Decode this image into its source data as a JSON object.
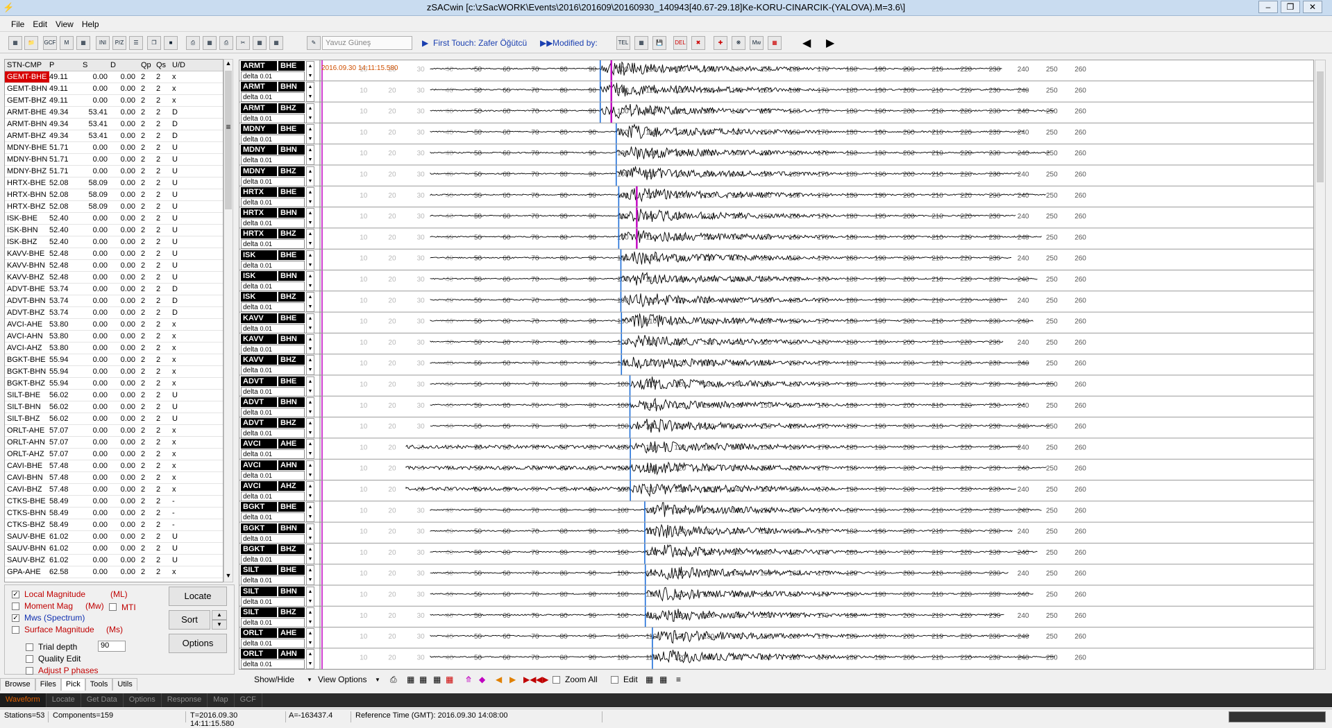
{
  "window": {
    "title": "zSACwin [c:\\zSacWORK\\Events\\2016\\201609\\20160930_140943[40.67-29.18]Ke-KORU-CINARCIK-(YALOVA).M=3.6\\]"
  },
  "menu": [
    "File",
    "Edit",
    "View",
    "Help"
  ],
  "toolbar": {
    "icons": [
      "gcf-icon",
      "ini-icon",
      "pole-zero-icon",
      "save-icon"
    ],
    "analyst_placeholder": "Yavuz Güneş",
    "first_touch": "First Touch: Zafer Öğütcü",
    "modified_by": "Modified by:"
  },
  "station_table": {
    "headers": [
      "STN-CMP",
      "P",
      "S",
      "D",
      "Qp",
      "Qs",
      "U/D"
    ],
    "rows": [
      [
        "GEMT-BHE",
        "49.11",
        "0.00",
        "0.00",
        "2",
        "2",
        "x"
      ],
      [
        "GEMT-BHN",
        "49.11",
        "0.00",
        "0.00",
        "2",
        "2",
        "x"
      ],
      [
        "GEMT-BHZ",
        "49.11",
        "0.00",
        "0.00",
        "2",
        "2",
        "x"
      ],
      [
        "ARMT-BHE",
        "49.34",
        "53.41",
        "0.00",
        "2",
        "2",
        "D"
      ],
      [
        "ARMT-BHN",
        "49.34",
        "53.41",
        "0.00",
        "2",
        "2",
        "D"
      ],
      [
        "ARMT-BHZ",
        "49.34",
        "53.41",
        "0.00",
        "2",
        "2",
        "D"
      ],
      [
        "MDNY-BHE",
        "51.71",
        "0.00",
        "0.00",
        "2",
        "2",
        "U"
      ],
      [
        "MDNY-BHN",
        "51.71",
        "0.00",
        "0.00",
        "2",
        "2",
        "U"
      ],
      [
        "MDNY-BHZ",
        "51.71",
        "0.00",
        "0.00",
        "2",
        "2",
        "U"
      ],
      [
        "HRTX-BHE",
        "52.08",
        "58.09",
        "0.00",
        "2",
        "2",
        "U"
      ],
      [
        "HRTX-BHN",
        "52.08",
        "58.09",
        "0.00",
        "2",
        "2",
        "U"
      ],
      [
        "HRTX-BHZ",
        "52.08",
        "58.09",
        "0.00",
        "2",
        "2",
        "U"
      ],
      [
        "ISK-BHE",
        "52.40",
        "0.00",
        "0.00",
        "2",
        "2",
        "U"
      ],
      [
        "ISK-BHN",
        "52.40",
        "0.00",
        "0.00",
        "2",
        "2",
        "U"
      ],
      [
        "ISK-BHZ",
        "52.40",
        "0.00",
        "0.00",
        "2",
        "2",
        "U"
      ],
      [
        "KAVV-BHE",
        "52.48",
        "0.00",
        "0.00",
        "2",
        "2",
        "U"
      ],
      [
        "KAVV-BHN",
        "52.48",
        "0.00",
        "0.00",
        "2",
        "2",
        "U"
      ],
      [
        "KAVV-BHZ",
        "52.48",
        "0.00",
        "0.00",
        "2",
        "2",
        "U"
      ],
      [
        "ADVT-BHE",
        "53.74",
        "0.00",
        "0.00",
        "2",
        "2",
        "D"
      ],
      [
        "ADVT-BHN",
        "53.74",
        "0.00",
        "0.00",
        "2",
        "2",
        "D"
      ],
      [
        "ADVT-BHZ",
        "53.74",
        "0.00",
        "0.00",
        "2",
        "2",
        "D"
      ],
      [
        "AVCI-AHE",
        "53.80",
        "0.00",
        "0.00",
        "2",
        "2",
        "x"
      ],
      [
        "AVCI-AHN",
        "53.80",
        "0.00",
        "0.00",
        "2",
        "2",
        "x"
      ],
      [
        "AVCI-AHZ",
        "53.80",
        "0.00",
        "0.00",
        "2",
        "2",
        "x"
      ],
      [
        "BGKT-BHE",
        "55.94",
        "0.00",
        "0.00",
        "2",
        "2",
        "x"
      ],
      [
        "BGKT-BHN",
        "55.94",
        "0.00",
        "0.00",
        "2",
        "2",
        "x"
      ],
      [
        "BGKT-BHZ",
        "55.94",
        "0.00",
        "0.00",
        "2",
        "2",
        "x"
      ],
      [
        "SILT-BHE",
        "56.02",
        "0.00",
        "0.00",
        "2",
        "2",
        "U"
      ],
      [
        "SILT-BHN",
        "56.02",
        "0.00",
        "0.00",
        "2",
        "2",
        "U"
      ],
      [
        "SILT-BHZ",
        "56.02",
        "0.00",
        "0.00",
        "2",
        "2",
        "U"
      ],
      [
        "ORLT-AHE",
        "57.07",
        "0.00",
        "0.00",
        "2",
        "2",
        "x"
      ],
      [
        "ORLT-AHN",
        "57.07",
        "0.00",
        "0.00",
        "2",
        "2",
        "x"
      ],
      [
        "ORLT-AHZ",
        "57.07",
        "0.00",
        "0.00",
        "2",
        "2",
        "x"
      ],
      [
        "CAVI-BHE",
        "57.48",
        "0.00",
        "0.00",
        "2",
        "2",
        "x"
      ],
      [
        "CAVI-BHN",
        "57.48",
        "0.00",
        "0.00",
        "2",
        "2",
        "x"
      ],
      [
        "CAVI-BHZ",
        "57.48",
        "0.00",
        "0.00",
        "2",
        "2",
        "x"
      ],
      [
        "CTKS-BHE",
        "58.49",
        "0.00",
        "0.00",
        "2",
        "2",
        "-"
      ],
      [
        "CTKS-BHN",
        "58.49",
        "0.00",
        "0.00",
        "2",
        "2",
        "-"
      ],
      [
        "CTKS-BHZ",
        "58.49",
        "0.00",
        "0.00",
        "2",
        "2",
        "-"
      ],
      [
        "SAUV-BHE",
        "61.02",
        "0.00",
        "0.00",
        "2",
        "2",
        "U"
      ],
      [
        "SAUV-BHN",
        "61.02",
        "0.00",
        "0.00",
        "2",
        "2",
        "U"
      ],
      [
        "SAUV-BHZ",
        "61.02",
        "0.00",
        "0.00",
        "2",
        "2",
        "U"
      ],
      [
        "GPA-AHE",
        "62.58",
        "0.00",
        "0.00",
        "2",
        "2",
        "x"
      ]
    ]
  },
  "magnitude": {
    "local": "Local Magnitude",
    "local_abbr": "(ML)",
    "moment": "Moment Mag",
    "moment_abbr": "(Mw)",
    "mti": "MTI",
    "mws": "Mws (Spectrum)",
    "surface": "Surface Magnitude",
    "surface_abbr": "(Ms)",
    "trial_depth": "Trial depth",
    "trial_depth_value": "90",
    "quality_edit": "Quality Edit",
    "adjust_p": "Adjust P phases"
  },
  "buttons": {
    "locate": "Locate",
    "sort": "Sort",
    "options": "Options"
  },
  "left_tabs": [
    "Browse",
    "Files",
    "Pick",
    "Tools",
    "Utils"
  ],
  "waveform": {
    "reference_label": "2016.09.30 14:11:15.580",
    "delta_label": "delta",
    "delta_value": "0.01",
    "channels": [
      [
        "ARMT",
        "BHE"
      ],
      [
        "ARMT",
        "BHN"
      ],
      [
        "ARMT",
        "BHZ"
      ],
      [
        "MDNY",
        "BHE"
      ],
      [
        "MDNY",
        "BHN"
      ],
      [
        "MDNY",
        "BHZ"
      ],
      [
        "HRTX",
        "BHE"
      ],
      [
        "HRTX",
        "BHN"
      ],
      [
        "HRTX",
        "BHZ"
      ],
      [
        "ISK",
        "BHE"
      ],
      [
        "ISK",
        "BHN"
      ],
      [
        "ISK",
        "BHZ"
      ],
      [
        "KAVV",
        "BHE"
      ],
      [
        "KAVV",
        "BHN"
      ],
      [
        "KAVV",
        "BHZ"
      ],
      [
        "ADVT",
        "BHE"
      ],
      [
        "ADVT",
        "BHN"
      ],
      [
        "ADVT",
        "BHZ"
      ],
      [
        "AVCI",
        "AHE"
      ],
      [
        "AVCI",
        "AHN"
      ],
      [
        "AVCI",
        "AHZ"
      ],
      [
        "BGKT",
        "BHE"
      ],
      [
        "BGKT",
        "BHN"
      ],
      [
        "BGKT",
        "BHZ"
      ],
      [
        "SILT",
        "BHE"
      ],
      [
        "SILT",
        "BHN"
      ],
      [
        "SILT",
        "BHZ"
      ],
      [
        "ORLT",
        "AHE"
      ],
      [
        "ORLT",
        "AHN"
      ]
    ],
    "p_picks": [
      49.34,
      49.34,
      49.34,
      51.71,
      51.71,
      51.71,
      52.08,
      52.08,
      52.08,
      52.4,
      52.4,
      52.4,
      52.48,
      52.48,
      52.48,
      53.74,
      53.74,
      53.74,
      53.8,
      53.8,
      53.8,
      55.94,
      55.94,
      55.94,
      56.02,
      56.02,
      56.02,
      57.07,
      57.07
    ],
    "time_ticks": [
      "10",
      "20",
      "30",
      "40",
      "50",
      "60",
      "70",
      "80",
      "90",
      "100",
      "110",
      "120",
      "130",
      "140",
      "150",
      "160",
      "170",
      "180",
      "190",
      "200",
      "210",
      "220",
      "230",
      "240",
      "250",
      "260"
    ],
    "colors": {
      "p_pick": "#1e6ed8",
      "s_pick": "#c000c0",
      "trace": "#000000",
      "ref_line": "#c000c0"
    }
  },
  "wave_toolbar": {
    "show_hide": "Show/Hide",
    "view_options": "View Options",
    "zoom_all": "Zoom All",
    "edit": "Edit"
  },
  "bottom_tabs": [
    "Waveform",
    "Locate",
    "Get Data",
    "Options",
    "Response",
    "Map",
    "GCF"
  ],
  "status": {
    "stations": "Stations=53",
    "components": "Components=159",
    "time": "T=2016.09.30 14:11:15.580",
    "amplitude": "A=-163437.4",
    "reference": "Reference Time (GMT): 2016.09.30 14:08:00"
  }
}
